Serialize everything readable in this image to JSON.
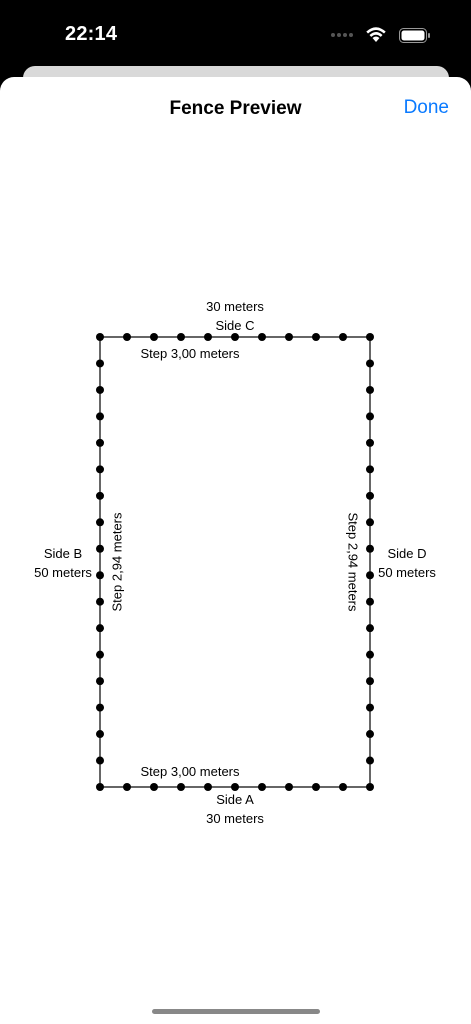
{
  "status": {
    "time": "22:14"
  },
  "sheet": {
    "title": "Fence Preview",
    "done_label": "Done"
  },
  "fence": {
    "side_a": {
      "name": "Side A",
      "length": "30 meters",
      "step": "Step 3,00 meters"
    },
    "side_b": {
      "name": "Side B",
      "length": "50 meters",
      "step": "Step 2,94 meters"
    },
    "side_c": {
      "name": "Side C",
      "length": "30 meters",
      "step": "Step 3,00 meters"
    },
    "side_d": {
      "name": "Side D",
      "length": "50 meters",
      "step": "Step 2,94 meters"
    }
  }
}
